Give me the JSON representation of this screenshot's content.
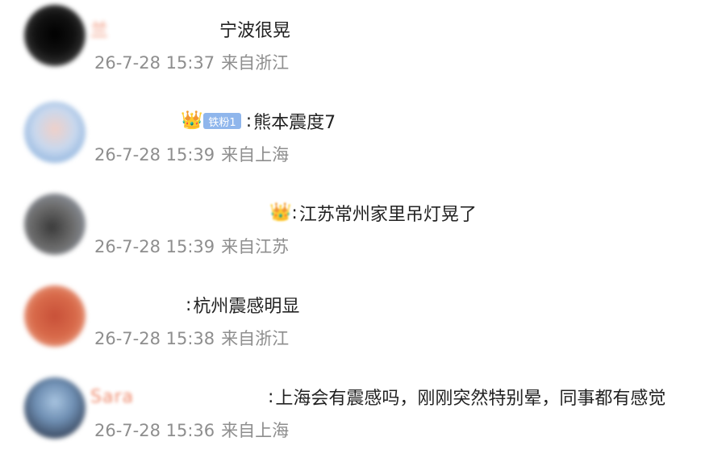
{
  "comments": [
    {
      "username": "兰",
      "text": "宁波很晃",
      "timestamp": "26-7-28 15:37",
      "location": "来自浙江",
      "avatar_color": "#1a1a1a"
    },
    {
      "username": "",
      "badge": "铁粉1",
      "text": "熊本震度7",
      "timestamp": "26-7-28 15:39",
      "location": "来自上海",
      "avatar_color": "#9cc0e6"
    },
    {
      "username": "",
      "text": "江苏常州家里吊灯晃了",
      "timestamp": "26-7-28 15:39",
      "location": "来自江苏",
      "avatar_color": "#6d6a66"
    },
    {
      "username": "",
      "text": "杭州震感明显",
      "timestamp": "26-7-28 15:38",
      "location": "来自浙江",
      "avatar_color": "#d86a4a"
    },
    {
      "username": "Sara",
      "text": "上海会有震感吗，刚刚突然特别晕，同事都有感觉",
      "timestamp": "26-7-28 15:36",
      "location": "来自上海",
      "avatar_color": "#4e6a8c"
    }
  ],
  "theme": {
    "username_color": "#eb7350",
    "meta_color": "#8e8e8e",
    "text_color": "#222222",
    "badge_color": "#8fb6ec"
  },
  "icons": {
    "crown": "crown-icon"
  }
}
